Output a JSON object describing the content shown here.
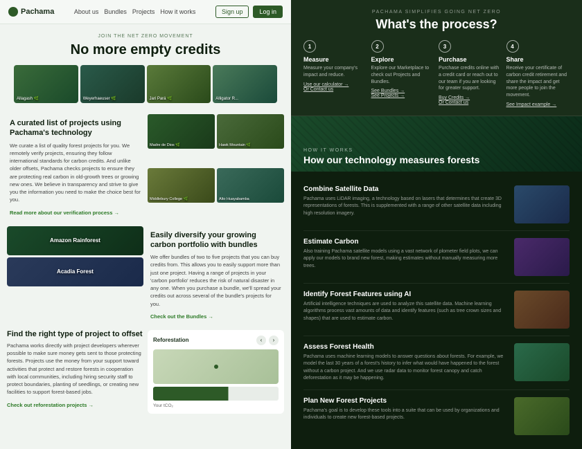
{
  "left": {
    "nav": {
      "logo": "Pachama",
      "links": [
        "About us",
        "Bundles",
        "Projects",
        "How it works"
      ],
      "signup": "Sign up",
      "login": "Log in"
    },
    "hero": {
      "tag": "JOIN THE NET ZERO MOVEMENT",
      "title": "No more empty credits"
    },
    "hero_images": [
      {
        "label": "Allagash 🌿",
        "class": "img-allagash"
      },
      {
        "label": "Weyerhaeuser 🌿",
        "class": "img-weyerhaeuser"
      },
      {
        "label": "Jari Pará 🌿",
        "class": "img-jariperu"
      },
      {
        "label": "Alligator R...",
        "class": "img-alligator"
      }
    ],
    "curated": {
      "heading": "A curated list of projects using Pachama's technology",
      "body": "We curate a list of quality forest projects for you. We remotely verify projects, ensuring they follow international standards for carbon credits. And unlike older offsets, Pachama checks projects to ensure they are protecting real carbon in old-growth trees or growing new ones. We believe in transparency and strive to give you the information you need to make the choice best for you.",
      "link": "Read more about our verification process →",
      "images": [
        {
          "label": "Madre de Dios 🌿",
          "class": "img-madre"
        },
        {
          "label": "Hawk Mountain 🌿",
          "class": "img-hawk"
        },
        {
          "label": "Middlebury College 🌿",
          "class": "img-middlebury"
        },
        {
          "label": "Alto Huayabamba",
          "class": "img-alto"
        }
      ]
    },
    "bundles": {
      "heading": "Easily diversify your growing carbon portfolio with bundles",
      "body": "We offer bundles of two to five projects that you can buy credits from. This allows you to easily support more than just one project. Having a range of projects in your 'carbon portfolio' reduces the risk of natural disaster in any one. When you purchase a bundle, we'll spread your credits out across several of the bundle's projects for you.",
      "link": "Check out the Bundles →",
      "images": [
        {
          "label": "Amazon Rainforest",
          "class": "img-amazon"
        },
        {
          "label": "Acadia Forest",
          "class": "img-acadia"
        }
      ]
    },
    "reforestation": {
      "heading": "Find the right type of project to offset",
      "body": "Pachama works directly with project developers wherever possible to make sure money gets sent to those protecting forests. Projects use the money from your support toward activities that protect and restore forests in cooperation with local communities, including hiring security staff to protect boundaries, planting of seedlings, or creating new facilities to support forest-based jobs.",
      "link": "Check out reforestation projects →",
      "widget": {
        "title": "Reforestation",
        "bar_label": "Your tCO₂"
      }
    }
  },
  "right": {
    "process": {
      "tag": "PACHAMA SIMPLIFIES GOING NET ZERO",
      "title": "What's the process?",
      "steps": [
        {
          "num": "1",
          "title": "Measure",
          "desc": "Measure your company's impact and reduce.",
          "link": "Use our calculator →\nOr Contact us"
        },
        {
          "num": "2",
          "title": "Explore",
          "desc": "Explore our Marketplace to check out Projects and Bundles.",
          "link": "See Bundles →\nSee Projects →"
        },
        {
          "num": "3",
          "title": "Purchase",
          "desc": "Purchase credits online with a credit card or reach out to our team if you are looking for greater support.",
          "link": "Buy Credits →\nOr Contact us"
        },
        {
          "num": "4",
          "title": "Share",
          "desc": "Receive your certificate of carbon credit retirement and share the impact and get more people to join the movement.",
          "link": "See Impact example →"
        }
      ]
    },
    "tech": {
      "tag": "HOW IT WORKS",
      "title": "How our technology measures forests",
      "features": [
        {
          "title": "Combine Satellite Data",
          "desc": "Pachama uses LiDAR imaging, a technology based on lasers that determines that create 3D representations of forests. This is supplemented with a range of other satellite data including high resolution imagery.",
          "img_class": "fi-satellite"
        },
        {
          "title": "Estimate Carbon",
          "desc": "Also training Pachama satellite models using a vast network of plometer field plots, we can apply our models to brand new forest, making estimates without manually measuring more trees.",
          "img_class": "fi-carbon"
        },
        {
          "title": "Identify Forest Features using AI",
          "desc": "Artificial intelligence techniques are used to analyze this satellite data. Machine learning algorithms process vast amounts of data and identify features (such as tree crown sizes and shapes) that are used to estimate carbon.",
          "img_class": "fi-ai"
        },
        {
          "title": "Assess Forest Health",
          "desc": "Pachama uses machine learning models to answer questions about forests. For example, we model the last 30 years of a forest's history to infer what would have happened to the forest without a carbon project. And we use radar data to monitor forest canopy and catch deforestation as it may be happening.",
          "img_class": "fi-health"
        },
        {
          "title": "Plan New Forest Projects",
          "desc": "Pachama's goal is to develop these tools into a suite that can be used by organizations and individuals to create new forest-based projects.",
          "img_class": "fi-new"
        }
      ]
    }
  }
}
